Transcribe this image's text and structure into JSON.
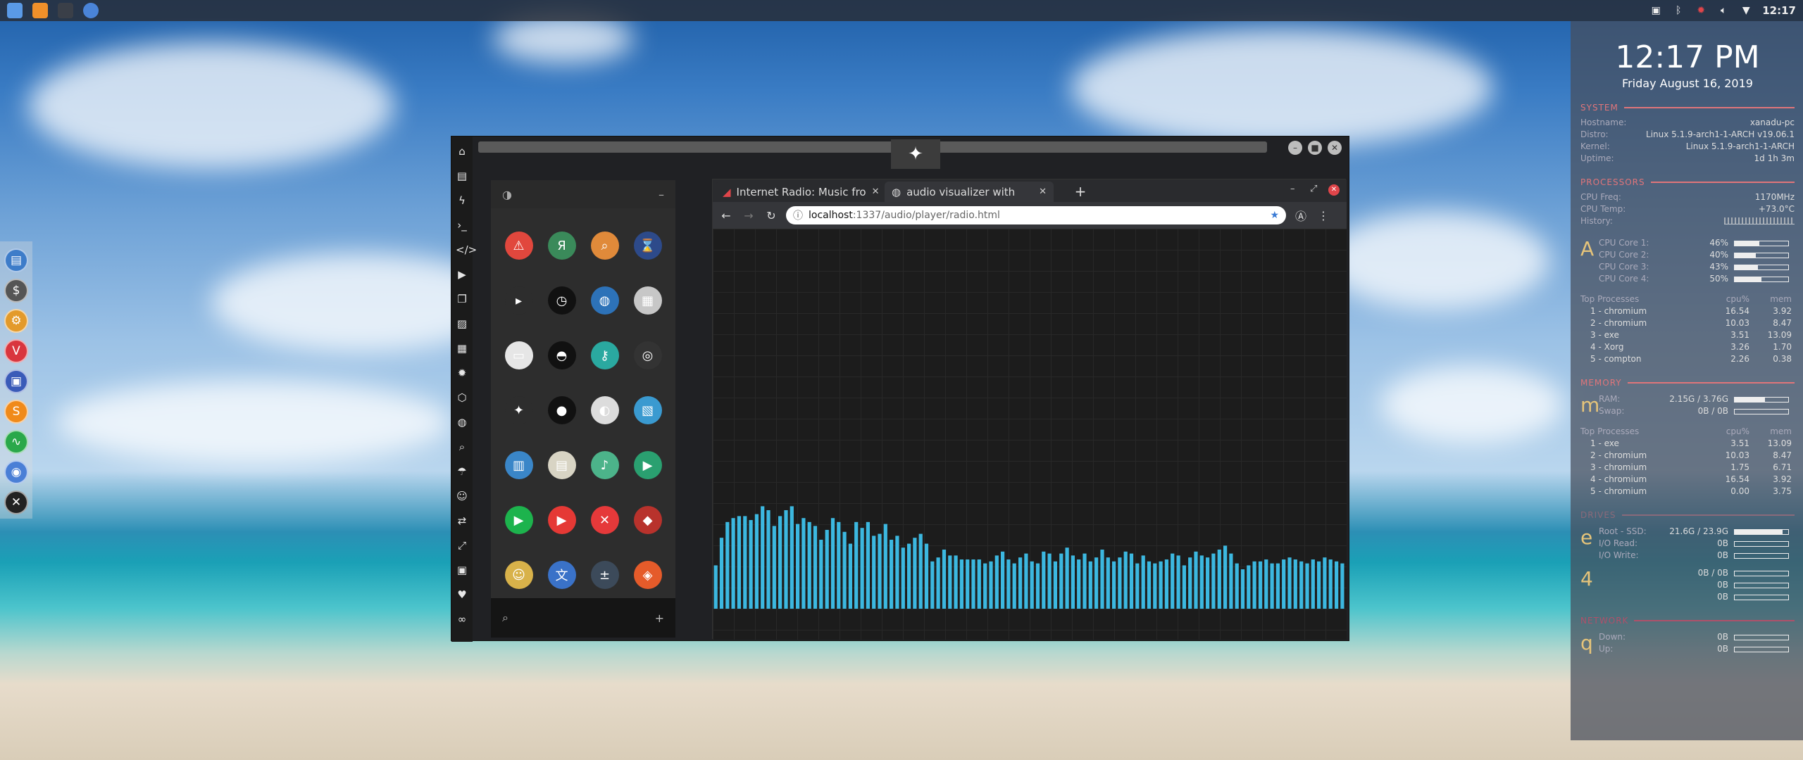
{
  "top_panel": {
    "launcher_icons": [
      "files-icon",
      "sublime-icon",
      "blank-icon",
      "chrome-icon"
    ],
    "tray_icons": [
      "screenshot-icon",
      "bluetooth-icon",
      "settings-icon",
      "volume-icon",
      "wifi-icon"
    ],
    "clock": "12:17"
  },
  "left_dock": {
    "items": [
      {
        "name": "files-dock-icon",
        "glyph": "▤",
        "color": "#3d7cc9"
      },
      {
        "name": "money-dock-icon",
        "glyph": "$",
        "color": "#555"
      },
      {
        "name": "settings-dock-icon",
        "glyph": "⚙",
        "color": "#e39a2b"
      },
      {
        "name": "vivaldi-dock-icon",
        "glyph": "V",
        "color": "#d9363e"
      },
      {
        "name": "display-dock-icon",
        "glyph": "▣",
        "color": "#3a5bb8"
      },
      {
        "name": "sublime-dock-icon",
        "glyph": "S",
        "color": "#f08a1a"
      },
      {
        "name": "monitor-dock-icon",
        "glyph": "∿",
        "color": "#2aa84a"
      },
      {
        "name": "chrome-dock-icon",
        "glyph": "◉",
        "color": "#4a7fd6"
      },
      {
        "name": "xorg-dock-icon",
        "glyph": "✕",
        "color": "#222"
      }
    ]
  },
  "side_rail": {
    "items": [
      "home-icon",
      "document-icon",
      "lightning-icon",
      "terminal-icon",
      "code-icon",
      "play-icon",
      "files-icon",
      "image-icon",
      "media-icon",
      "settings-icon",
      "hexagon-icon",
      "globe-icon",
      "search-icon",
      "umbrella-icon",
      "person-icon",
      "share-icon",
      "expand-icon",
      "youtube-icon",
      "heart-icon",
      "infinity-icon"
    ]
  },
  "app_panel": {
    "header_left": "◑",
    "header_right": "–",
    "search_icon": "⌕",
    "search_add": "+",
    "apps": [
      {
        "name": "warning-app-icon",
        "glyph": "⚠",
        "color": "#e1473d"
      },
      {
        "name": "yandex-app-icon",
        "glyph": "Я",
        "color": "#3a8a5a"
      },
      {
        "name": "search-app-icon",
        "glyph": "⌕",
        "color": "#e08a3a"
      },
      {
        "name": "hourglass-app-icon",
        "glyph": "⌛",
        "color": "#2d4a8a"
      },
      {
        "name": "sublime-app-icon",
        "glyph": "▸",
        "color": "#2d2d2d"
      },
      {
        "name": "clock-app-icon",
        "glyph": "◷",
        "color": "#111"
      },
      {
        "name": "globe-app-icon",
        "glyph": "◍",
        "color": "#2d72b8"
      },
      {
        "name": "drive-app-icon",
        "glyph": "▦",
        "color": "#c7c7c7"
      },
      {
        "name": "window-app-icon",
        "glyph": "▭",
        "color": "#e6e6e6"
      },
      {
        "name": "helmet-app-icon",
        "glyph": "◓",
        "color": "#111"
      },
      {
        "name": "lock-app-icon",
        "glyph": "⚷",
        "color": "#2aa9a0"
      },
      {
        "name": "github-app-icon",
        "glyph": "◎",
        "color": "#333"
      },
      {
        "name": "rebel-app-icon",
        "glyph": "✦",
        "color": "#2d2d2d"
      },
      {
        "name": "deathstar-app-icon",
        "glyph": "●",
        "color": "#111"
      },
      {
        "name": "moon-app-icon",
        "glyph": "◐",
        "color": "#dcdcdc"
      },
      {
        "name": "map-app-icon",
        "glyph": "▧",
        "color": "#3a9ad0"
      },
      {
        "name": "books-app-icon",
        "glyph": "▥",
        "color": "#3a86c8"
      },
      {
        "name": "notes-app-icon",
        "glyph": "▤",
        "color": "#d8d4c4"
      },
      {
        "name": "music-app-icon",
        "glyph": "♪",
        "color": "#4cb38a"
      },
      {
        "name": "video-app-icon",
        "glyph": "▶",
        "color": "#2aa070"
      },
      {
        "name": "player-app-icon",
        "glyph": "▶",
        "color": "#1db34d"
      },
      {
        "name": "youtube-app-icon",
        "glyph": "▶",
        "color": "#e53935"
      },
      {
        "name": "close-app-icon",
        "glyph": "✕",
        "color": "#e5393a"
      },
      {
        "name": "ironman-app-icon",
        "glyph": "◆",
        "color": "#b8322c"
      },
      {
        "name": "robot-app-icon",
        "glyph": "☺",
        "color": "#d8b24a"
      },
      {
        "name": "translate-app-icon",
        "glyph": "文",
        "color": "#3a72c8"
      },
      {
        "name": "calculator-app-icon",
        "glyph": "±",
        "color": "#3c4a5a"
      },
      {
        "name": "photos-app-icon",
        "glyph": "◈",
        "color": "#e55b2a"
      }
    ]
  },
  "browser": {
    "tabs": [
      {
        "label": "Internet Radio: Music fro",
        "icon": "radio-icon",
        "active": false
      },
      {
        "label": "audio visualizer with",
        "icon": "globe-icon",
        "active": true
      }
    ],
    "new_tab": "+",
    "window_controls": [
      "–",
      "⤢",
      "✕"
    ],
    "nav": {
      "back": "←",
      "forward": "→",
      "reload": "↻"
    },
    "address": {
      "host": "localhost",
      "path": ":1337/audio/player/radio.html"
    },
    "bookmark_star": "★",
    "extension": "Ⓐ",
    "menu": "⋮",
    "visualizer": {
      "color": "#3cb8e0",
      "levels": [
        0.22,
        0.36,
        0.44,
        0.46,
        0.47,
        0.47,
        0.45,
        0.48,
        0.52,
        0.5,
        0.42,
        0.47,
        0.5,
        0.52,
        0.43,
        0.46,
        0.44,
        0.42,
        0.35,
        0.4,
        0.46,
        0.44,
        0.39,
        0.33,
        0.44,
        0.41,
        0.44,
        0.37,
        0.38,
        0.43,
        0.35,
        0.37,
        0.31,
        0.33,
        0.36,
        0.38,
        0.33,
        0.24,
        0.26,
        0.3,
        0.27,
        0.27,
        0.25,
        0.25,
        0.25,
        0.25,
        0.23,
        0.24,
        0.27,
        0.29,
        0.25,
        0.23,
        0.26,
        0.28,
        0.24,
        0.23,
        0.29,
        0.28,
        0.24,
        0.28,
        0.31,
        0.27,
        0.25,
        0.28,
        0.24,
        0.26,
        0.3,
        0.26,
        0.24,
        0.26,
        0.29,
        0.28,
        0.23,
        0.27,
        0.24,
        0.23,
        0.24,
        0.25,
        0.28,
        0.27,
        0.22,
        0.26,
        0.29,
        0.27,
        0.26,
        0.28,
        0.3,
        0.32,
        0.28,
        0.23,
        0.2,
        0.22,
        0.24,
        0.24,
        0.25,
        0.23,
        0.23,
        0.25,
        0.26,
        0.25,
        0.24,
        0.23,
        0.25,
        0.24,
        0.26,
        0.25,
        0.24,
        0.23
      ]
    }
  },
  "conky": {
    "time": "12:17 PM",
    "date": "Friday August 16, 2019",
    "system": {
      "title": "SYSTEM",
      "rows": [
        {
          "k": "Hostname:",
          "v": "xanadu-pc"
        },
        {
          "k": "Distro:",
          "v": "Linux 5.1.9-arch1-1-ARCH v19.06.1"
        },
        {
          "k": "Kernel:",
          "v": "Linux 5.1.9-arch1-1-ARCH"
        },
        {
          "k": "Uptime:",
          "v": "1d 1h 3m"
        }
      ]
    },
    "processors": {
      "title": "PROCESSORS",
      "freq_label": "CPU Freq:",
      "freq": "1170MHz",
      "temp_label": "CPU Temp:",
      "temp": "+73.0°C",
      "history_label": "History:",
      "letter": "A",
      "cores": [
        {
          "name": "CPU Core 1:",
          "pct": "46%",
          "level": 0.46
        },
        {
          "name": "CPU Core 2:",
          "pct": "40%",
          "level": 0.4
        },
        {
          "name": "CPU Core 3:",
          "pct": "43%",
          "level": 0.43
        },
        {
          "name": "CPU Core 4:",
          "pct": "50%",
          "level": 0.5
        }
      ],
      "top_title": "Top Processes",
      "col_cpu": "cpu%",
      "col_mem": "mem",
      "top": [
        {
          "n": "1 - chromium",
          "c": "16.54",
          "m": "3.92"
        },
        {
          "n": "2 - chromium",
          "c": "10.03",
          "m": "8.47"
        },
        {
          "n": "3 - exe",
          "c": "3.51",
          "m": "13.09"
        },
        {
          "n": "4 - Xorg",
          "c": "3.26",
          "m": "1.70"
        },
        {
          "n": "5 - compton",
          "c": "2.26",
          "m": "0.38"
        }
      ]
    },
    "memory": {
      "title": "MEMORY",
      "letter": "m",
      "ram_label": "RAM:",
      "ram": "2.15G / 3.76G",
      "ram_level": 0.57,
      "swap_label": "Swap:",
      "swap": "0B / 0B",
      "swap_level": 0,
      "top_title": "Top Processes",
      "col_cpu": "cpu%",
      "col_mem": "mem",
      "top": [
        {
          "n": "1 - exe",
          "c": "3.51",
          "m": "13.09"
        },
        {
          "n": "2 - chromium",
          "c": "10.03",
          "m": "8.47"
        },
        {
          "n": "3 - chromium",
          "c": "1.75",
          "m": "6.71"
        },
        {
          "n": "4 - chromium",
          "c": "16.54",
          "m": "3.92"
        },
        {
          "n": "5 - chromium",
          "c": "0.00",
          "m": "3.75"
        }
      ]
    },
    "drives": {
      "title": "DRIVES",
      "letter1": "e",
      "root_label": "Root - SSD:",
      "root": "21.6G / 23.9G",
      "root_level": 0.9,
      "read_label": "I/O Read:",
      "read": "0B",
      "write_label": "I/O Write:",
      "write": "0B",
      "letter2": "4",
      "hdd_value": "0B / 0B",
      "hdd_read": "0B",
      "hdd_write": "0B"
    },
    "network": {
      "title": "NETWORK",
      "letter": "q",
      "down_label": "Down:",
      "down": "0B",
      "up_label": "Up:",
      "up": "0B"
    }
  }
}
